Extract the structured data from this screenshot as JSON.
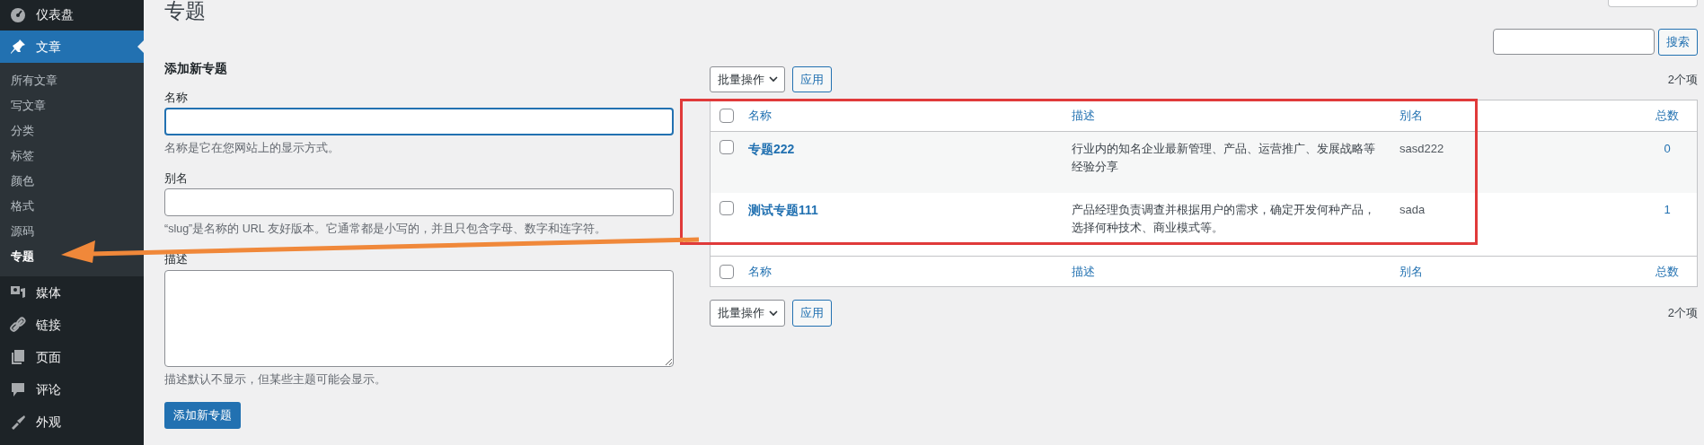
{
  "sidebar": {
    "items": [
      {
        "label": "仪表盘",
        "selected": false
      },
      {
        "label": "文章",
        "selected": true,
        "children": [
          {
            "label": "所有文章",
            "selected": false
          },
          {
            "label": "写文章",
            "selected": false
          },
          {
            "label": "分类",
            "selected": false
          },
          {
            "label": "标签",
            "selected": false
          },
          {
            "label": "颜色",
            "selected": false
          },
          {
            "label": "格式",
            "selected": false
          },
          {
            "label": "源码",
            "selected": false
          },
          {
            "label": "专题",
            "selected": true
          }
        ]
      },
      {
        "label": "媒体",
        "selected": false
      },
      {
        "label": "链接",
        "selected": false
      },
      {
        "label": "页面",
        "selected": false
      },
      {
        "label": "评论",
        "selected": false
      },
      {
        "label": "外观",
        "selected": false
      }
    ]
  },
  "page_title": "专题",
  "form": {
    "heading": "添加新专题",
    "fields": [
      {
        "kind": "input",
        "label": "名称",
        "focused": true,
        "help": "名称是它在您网站上的显示方式。"
      },
      {
        "kind": "input",
        "label": "别名",
        "focused": false,
        "help": "“slug”是名称的 URL 友好版本。它通常都是小写的，并且只包含字母、数字和连字符。"
      },
      {
        "kind": "textarea",
        "label": "描述",
        "focused": false,
        "help": "描述默认不显示，但某些主题可能会显示。"
      }
    ],
    "submit": "添加新专题"
  },
  "search": {
    "button": "搜索"
  },
  "top_nav": {
    "bulk_select": "批量操作",
    "apply": "应用",
    "count": "2个项"
  },
  "table": {
    "columns": [
      "名称",
      "描述",
      "别名",
      "总数"
    ],
    "header_checked": false,
    "rows": [
      {
        "checked": false,
        "name": "专题222",
        "description": "行业内的知名企业最新管理、产品、运营推广、发展战略等经验分享",
        "slug": "sasd222",
        "count": "0"
      },
      {
        "checked": false,
        "name": "测试专题111",
        "description": "产品经理负责调查并根据用户的需求，确定开发何种产品，选择何种技术、商业模式等。",
        "slug": "sada",
        "count": "1"
      }
    ],
    "footer_columns": [
      "名称",
      "描述",
      "别名",
      "总数"
    ],
    "footer_checked": false
  },
  "bottom_nav": {
    "bulk_select": "批量操作",
    "apply": "应用",
    "count": "2个项"
  }
}
